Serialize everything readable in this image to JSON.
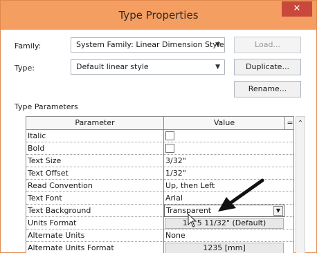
{
  "window": {
    "title": "Type Properties",
    "close_glyph": "✕"
  },
  "family": {
    "label": "Family:",
    "value": "System Family: Linear Dimension Style",
    "load_label": "Load..."
  },
  "type": {
    "label": "Type:",
    "value": "Default linear style",
    "duplicate_label": "Duplicate...",
    "rename_label": "Rename..."
  },
  "type_parameters": {
    "label": "Type Parameters",
    "columns": {
      "parameter": "Parameter",
      "value": "Value",
      "eq": "="
    },
    "rows": [
      {
        "parameter": "Italic",
        "value": "",
        "kind": "checkbox"
      },
      {
        "parameter": "Bold",
        "value": "",
        "kind": "checkbox"
      },
      {
        "parameter": "Text Size",
        "value": "3/32\"",
        "kind": "text"
      },
      {
        "parameter": "Text Offset",
        "value": "1/32\"",
        "kind": "text"
      },
      {
        "parameter": "Read Convention",
        "value": "Up, then Left",
        "kind": "text"
      },
      {
        "parameter": "Text Font",
        "value": "Arial",
        "kind": "text"
      },
      {
        "parameter": "Text Background",
        "value": "Transparent",
        "kind": "select"
      },
      {
        "parameter": "Units Format",
        "value": "1' - 5 11/32\" (Default)",
        "kind": "button"
      },
      {
        "parameter": "Alternate Units",
        "value": "None",
        "kind": "text"
      },
      {
        "parameter": "Alternate Units Format",
        "value": "1235 [mm]",
        "kind": "button"
      }
    ]
  },
  "icons": {
    "dropdown": "chevron-down-icon",
    "scroll_up": "chevron-up-icon",
    "annotation": "arrow-pointer-icon",
    "cursor": "mouse-cursor-icon"
  },
  "colors": {
    "titlebar": "#f59e62",
    "close": "#c9483c"
  }
}
